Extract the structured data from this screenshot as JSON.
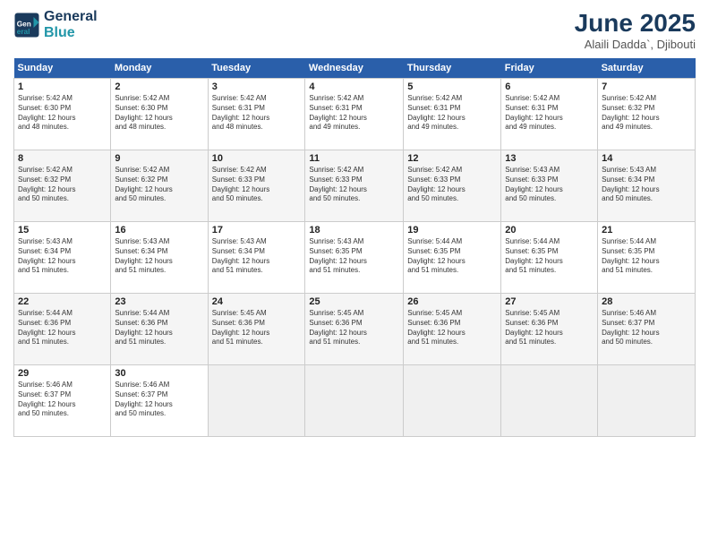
{
  "header": {
    "logo_line1": "General",
    "logo_line2": "Blue",
    "month": "June 2025",
    "location": "Alaili Dadda`, Djibouti"
  },
  "weekdays": [
    "Sunday",
    "Monday",
    "Tuesday",
    "Wednesday",
    "Thursday",
    "Friday",
    "Saturday"
  ],
  "weeks": [
    [
      {
        "day": "1",
        "info": "Sunrise: 5:42 AM\nSunset: 6:30 PM\nDaylight: 12 hours\nand 48 minutes."
      },
      {
        "day": "2",
        "info": "Sunrise: 5:42 AM\nSunset: 6:30 PM\nDaylight: 12 hours\nand 48 minutes."
      },
      {
        "day": "3",
        "info": "Sunrise: 5:42 AM\nSunset: 6:31 PM\nDaylight: 12 hours\nand 48 minutes."
      },
      {
        "day": "4",
        "info": "Sunrise: 5:42 AM\nSunset: 6:31 PM\nDaylight: 12 hours\nand 49 minutes."
      },
      {
        "day": "5",
        "info": "Sunrise: 5:42 AM\nSunset: 6:31 PM\nDaylight: 12 hours\nand 49 minutes."
      },
      {
        "day": "6",
        "info": "Sunrise: 5:42 AM\nSunset: 6:31 PM\nDaylight: 12 hours\nand 49 minutes."
      },
      {
        "day": "7",
        "info": "Sunrise: 5:42 AM\nSunset: 6:32 PM\nDaylight: 12 hours\nand 49 minutes."
      }
    ],
    [
      {
        "day": "8",
        "info": "Sunrise: 5:42 AM\nSunset: 6:32 PM\nDaylight: 12 hours\nand 50 minutes."
      },
      {
        "day": "9",
        "info": "Sunrise: 5:42 AM\nSunset: 6:32 PM\nDaylight: 12 hours\nand 50 minutes."
      },
      {
        "day": "10",
        "info": "Sunrise: 5:42 AM\nSunset: 6:33 PM\nDaylight: 12 hours\nand 50 minutes."
      },
      {
        "day": "11",
        "info": "Sunrise: 5:42 AM\nSunset: 6:33 PM\nDaylight: 12 hours\nand 50 minutes."
      },
      {
        "day": "12",
        "info": "Sunrise: 5:42 AM\nSunset: 6:33 PM\nDaylight: 12 hours\nand 50 minutes."
      },
      {
        "day": "13",
        "info": "Sunrise: 5:43 AM\nSunset: 6:33 PM\nDaylight: 12 hours\nand 50 minutes."
      },
      {
        "day": "14",
        "info": "Sunrise: 5:43 AM\nSunset: 6:34 PM\nDaylight: 12 hours\nand 50 minutes."
      }
    ],
    [
      {
        "day": "15",
        "info": "Sunrise: 5:43 AM\nSunset: 6:34 PM\nDaylight: 12 hours\nand 51 minutes."
      },
      {
        "day": "16",
        "info": "Sunrise: 5:43 AM\nSunset: 6:34 PM\nDaylight: 12 hours\nand 51 minutes."
      },
      {
        "day": "17",
        "info": "Sunrise: 5:43 AM\nSunset: 6:34 PM\nDaylight: 12 hours\nand 51 minutes."
      },
      {
        "day": "18",
        "info": "Sunrise: 5:43 AM\nSunset: 6:35 PM\nDaylight: 12 hours\nand 51 minutes."
      },
      {
        "day": "19",
        "info": "Sunrise: 5:44 AM\nSunset: 6:35 PM\nDaylight: 12 hours\nand 51 minutes."
      },
      {
        "day": "20",
        "info": "Sunrise: 5:44 AM\nSunset: 6:35 PM\nDaylight: 12 hours\nand 51 minutes."
      },
      {
        "day": "21",
        "info": "Sunrise: 5:44 AM\nSunset: 6:35 PM\nDaylight: 12 hours\nand 51 minutes."
      }
    ],
    [
      {
        "day": "22",
        "info": "Sunrise: 5:44 AM\nSunset: 6:36 PM\nDaylight: 12 hours\nand 51 minutes."
      },
      {
        "day": "23",
        "info": "Sunrise: 5:44 AM\nSunset: 6:36 PM\nDaylight: 12 hours\nand 51 minutes."
      },
      {
        "day": "24",
        "info": "Sunrise: 5:45 AM\nSunset: 6:36 PM\nDaylight: 12 hours\nand 51 minutes."
      },
      {
        "day": "25",
        "info": "Sunrise: 5:45 AM\nSunset: 6:36 PM\nDaylight: 12 hours\nand 51 minutes."
      },
      {
        "day": "26",
        "info": "Sunrise: 5:45 AM\nSunset: 6:36 PM\nDaylight: 12 hours\nand 51 minutes."
      },
      {
        "day": "27",
        "info": "Sunrise: 5:45 AM\nSunset: 6:36 PM\nDaylight: 12 hours\nand 51 minutes."
      },
      {
        "day": "28",
        "info": "Sunrise: 5:46 AM\nSunset: 6:37 PM\nDaylight: 12 hours\nand 50 minutes."
      }
    ],
    [
      {
        "day": "29",
        "info": "Sunrise: 5:46 AM\nSunset: 6:37 PM\nDaylight: 12 hours\nand 50 minutes."
      },
      {
        "day": "30",
        "info": "Sunrise: 5:46 AM\nSunset: 6:37 PM\nDaylight: 12 hours\nand 50 minutes."
      },
      {
        "day": "",
        "info": ""
      },
      {
        "day": "",
        "info": ""
      },
      {
        "day": "",
        "info": ""
      },
      {
        "day": "",
        "info": ""
      },
      {
        "day": "",
        "info": ""
      }
    ]
  ]
}
